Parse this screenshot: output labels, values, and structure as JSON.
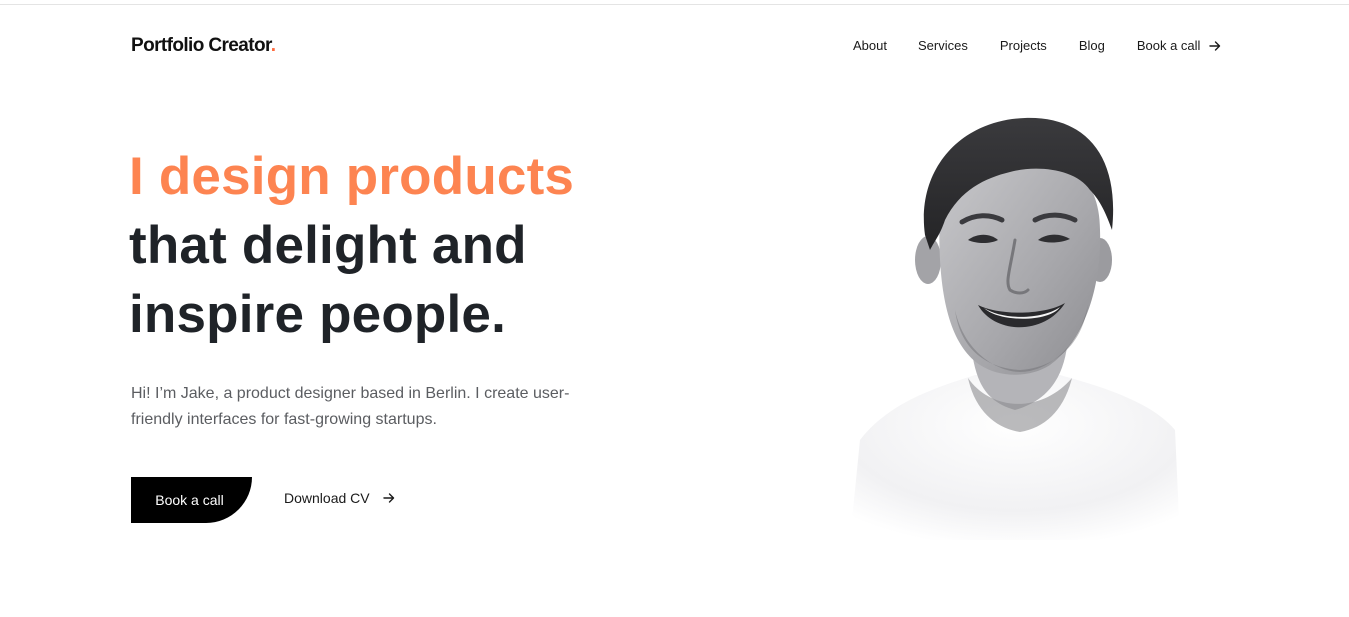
{
  "header": {
    "logo_text": "Portfolio Creator",
    "logo_dot": ".",
    "nav": {
      "about": "About",
      "services": "Services",
      "projects": "Projects",
      "blog": "Blog",
      "book_call": "Book a call"
    }
  },
  "hero": {
    "title_line1": "I design products",
    "title_line2": "that delight and",
    "title_line3": "inspire people.",
    "intro": "Hi! I’m Jake, a product designer based in Berlin. I create user-friendly interfaces for fast-growing startups.",
    "primary_button": "Book a call",
    "secondary_button": "Download CV"
  },
  "colors": {
    "accent": "#fd8451",
    "logo_dot": "#ff6a3d",
    "heading": "#1f2328",
    "body_text": "#5b5d61",
    "button_bg": "#000000"
  },
  "icons": {
    "nav_arrow": "arrow-right-icon",
    "cv_arrow": "arrow-right-icon",
    "portrait": "person-portrait-image"
  }
}
